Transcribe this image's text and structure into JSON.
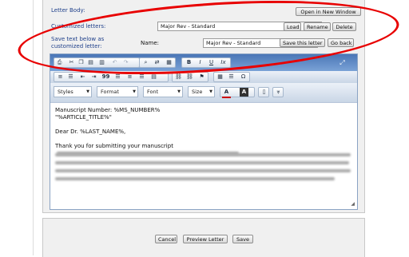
{
  "form": {
    "letter_body_label": "Letter Body:",
    "open_new_window": "Open in New Window",
    "customized_letters_label": "Customized letters:",
    "selected_letter": "Major Rev - Standard",
    "load": "Load",
    "rename": "Rename",
    "delete": "Delete",
    "save_text_label_1": "Save text below as",
    "save_text_label_2": "customized letter:",
    "name_label": "Name:",
    "name_value": "Major Rev - Standard",
    "save_letter": "Save this letter",
    "go_back": "Go back"
  },
  "toolbar": {
    "styles": "Styles",
    "format": "Format",
    "font": "Font",
    "size": "Size",
    "bold": "B",
    "italic": "I",
    "underline": "U",
    "clear_format": "Ix",
    "omega": "Ω",
    "blockquote": "99",
    "text_color": "A",
    "bg_color": "A"
  },
  "letter": {
    "line1": "Manuscript Number: %MS_NUMBER%",
    "line2": "\"%ARTICLE_TITLE%\"",
    "line3": "Dear Dr. %LAST_NAME%,",
    "line4": "Thank you for submitting your manuscript"
  },
  "actions": {
    "cancel": "Cancel",
    "preview": "Preview Letter",
    "save": "Save"
  },
  "colors": {
    "annotation": "#e80000",
    "label": "#1e3f8a",
    "toolbar_top": "#4a76b6"
  }
}
